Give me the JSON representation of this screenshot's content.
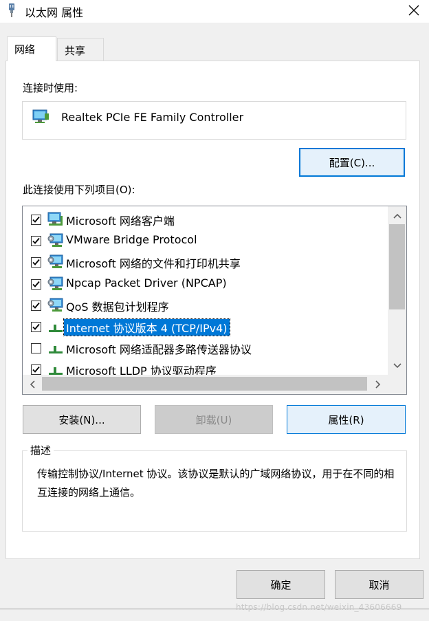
{
  "window": {
    "title": "以太网 属性"
  },
  "tabs": [
    {
      "label": "网络",
      "active": true
    },
    {
      "label": "共享",
      "active": false
    }
  ],
  "connect_using": {
    "label": "连接时使用:",
    "adapter": "Realtek PCIe FE Family Controller",
    "configure_button": "配置(C)..."
  },
  "items_section": {
    "label": "此连接使用下列项目(O):",
    "items": [
      {
        "label": "Microsoft 网络客户端",
        "checked": true,
        "icon": "network-client-icon"
      },
      {
        "label": "VMware Bridge Protocol",
        "checked": true,
        "icon": "network-service-icon"
      },
      {
        "label": "Microsoft 网络的文件和打印机共享",
        "checked": true,
        "icon": "network-service-icon"
      },
      {
        "label": "Npcap Packet Driver (NPCAP)",
        "checked": true,
        "icon": "network-service-icon"
      },
      {
        "label": "QoS 数据包计划程序",
        "checked": true,
        "icon": "network-service-icon"
      },
      {
        "label": "Internet 协议版本 4 (TCP/IPv4)",
        "checked": true,
        "selected": true,
        "icon": "protocol-icon"
      },
      {
        "label": "Microsoft 网络适配器多路传送器协议",
        "checked": false,
        "icon": "protocol-icon"
      },
      {
        "label": "Microsoft LLDP 协议驱动程序",
        "checked": true,
        "icon": "protocol-icon"
      }
    ]
  },
  "actions": {
    "install": "安装(N)...",
    "uninstall": "卸载(U)",
    "properties": "属性(R)"
  },
  "description": {
    "title": "描述",
    "text": "传输控制协议/Internet 协议。该协议是默认的广域网络协议，用于在不同的相互连接的网络上通信。"
  },
  "footer": {
    "ok": "确定",
    "cancel": "取消"
  },
  "watermark": "https://blog.csdn.net/weixin_43606669",
  "colors": {
    "accent": "#0078d7",
    "dialog_bg": "#f0f0f0",
    "panel_bg": "#ffffff"
  }
}
